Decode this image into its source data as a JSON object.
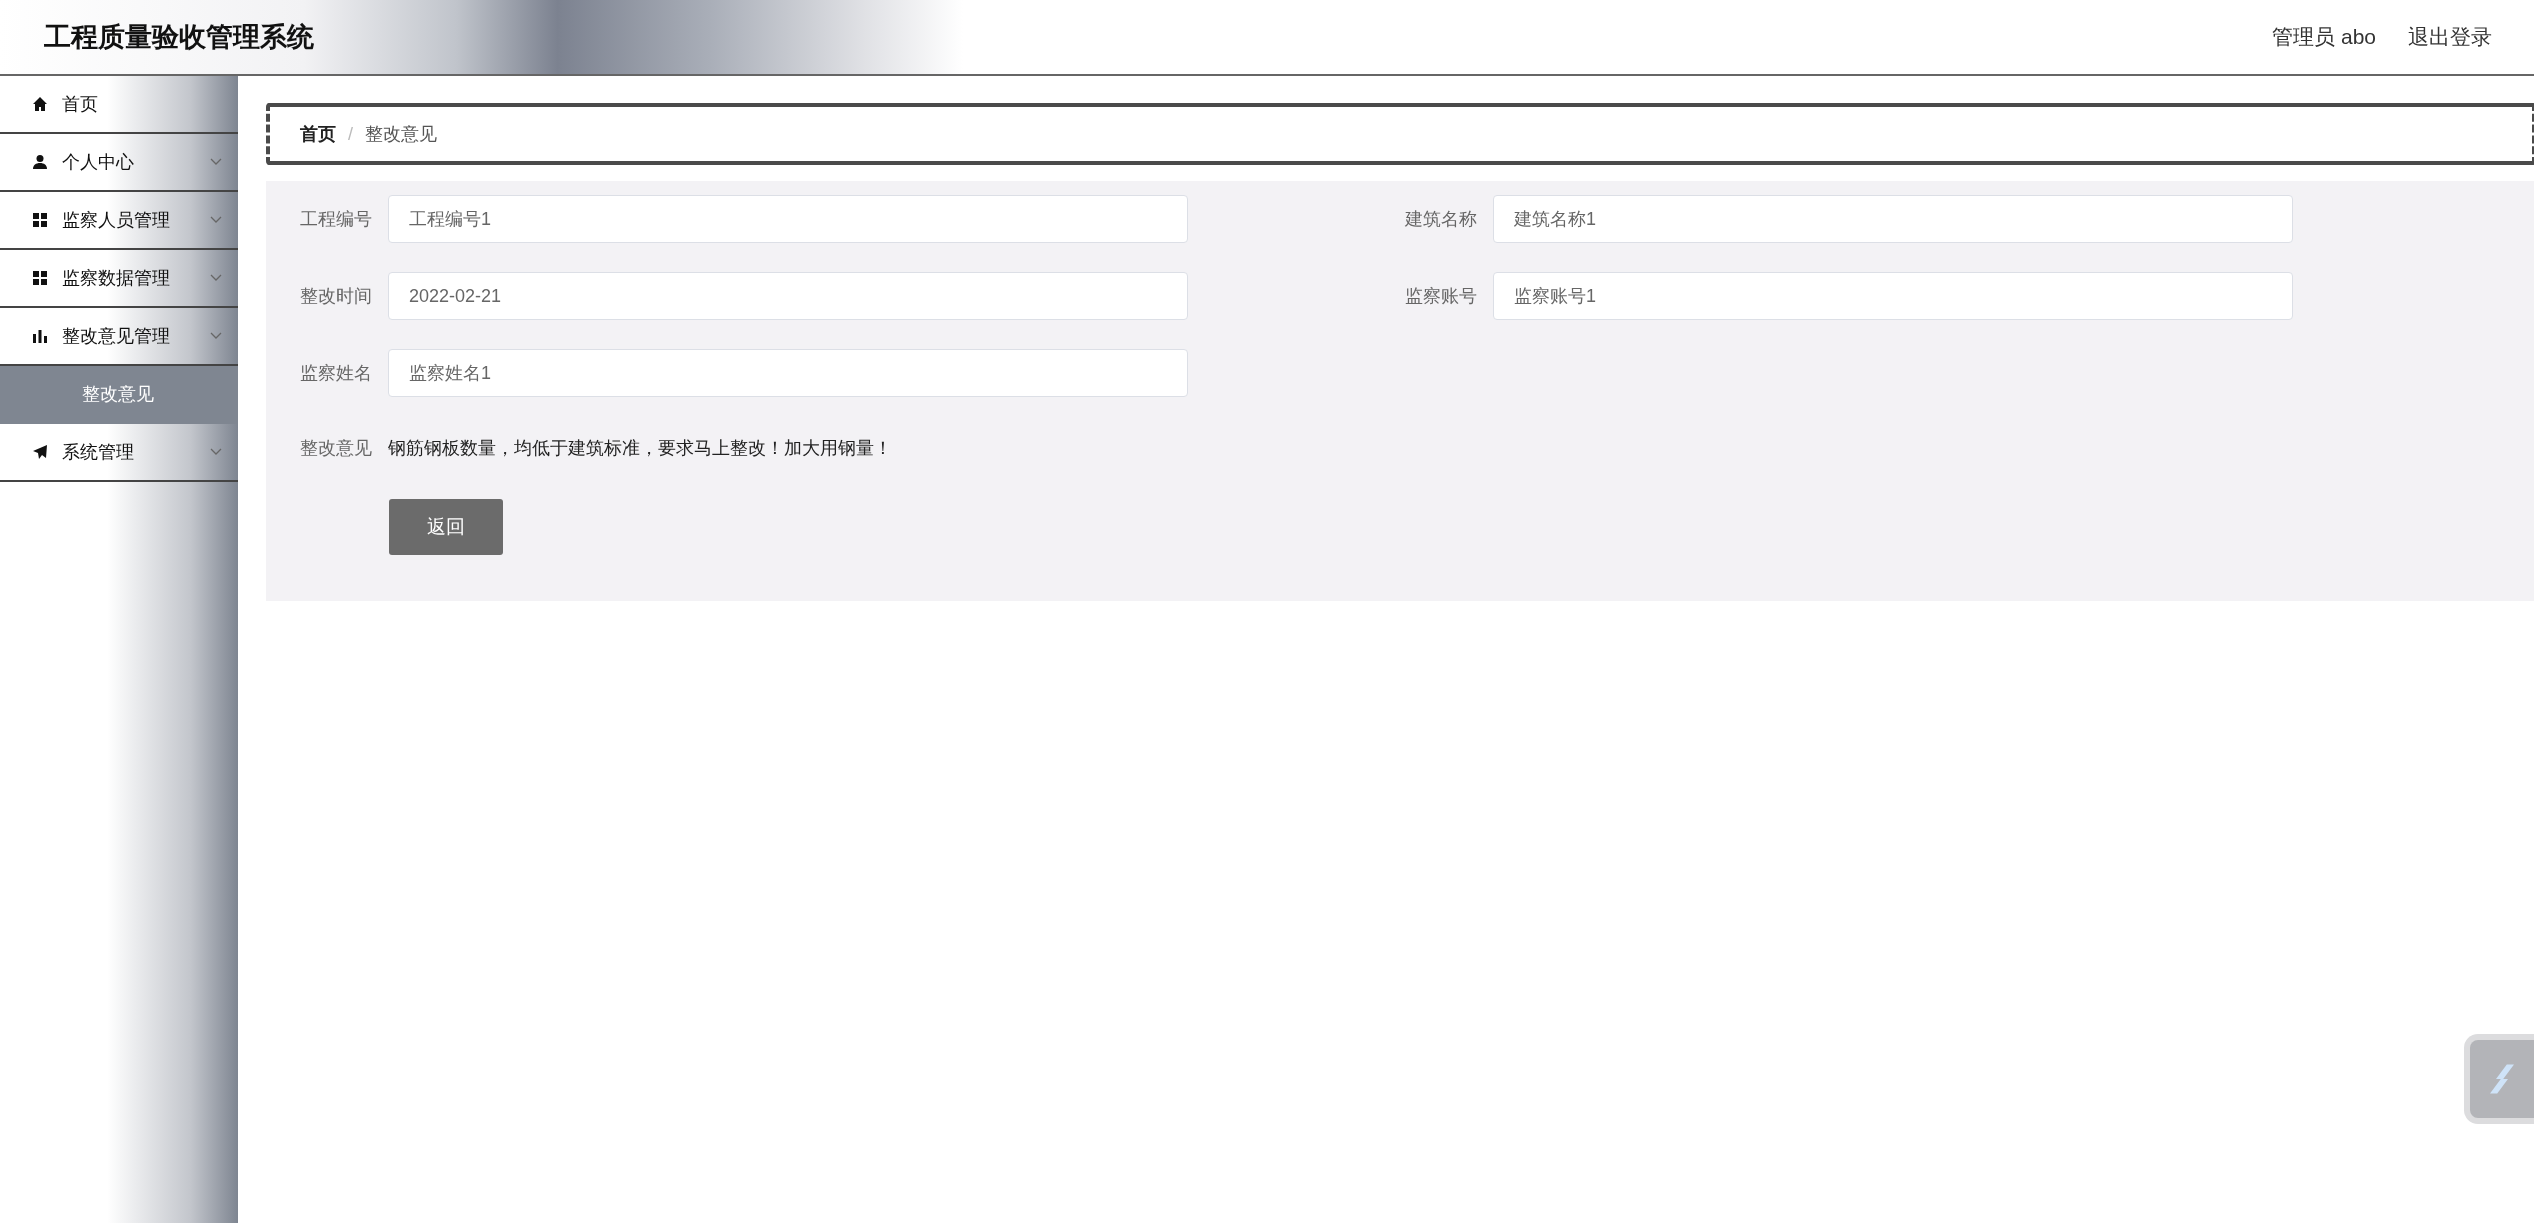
{
  "header": {
    "title": "工程质量验收管理系统",
    "user": "管理员 abo",
    "logout": "退出登录"
  },
  "sidebar": {
    "items": [
      {
        "label": "首页",
        "kind": "item",
        "selected": false
      },
      {
        "label": "个人中心",
        "kind": "group",
        "selected": false
      },
      {
        "label": "监察人员管理",
        "kind": "group",
        "selected": false
      },
      {
        "label": "监察数据管理",
        "kind": "group",
        "selected": false
      },
      {
        "label": "整改意见管理",
        "kind": "group",
        "selected": false,
        "children": [
          {
            "label": "整改意见",
            "selected": true
          }
        ]
      },
      {
        "label": "系统管理",
        "kind": "group",
        "selected": false
      }
    ]
  },
  "breadcrumb": {
    "items": [
      "首页",
      "整改意见"
    ],
    "separator": "/"
  },
  "form": {
    "rows": [
      [
        {
          "label": "工程编号",
          "kind": "input",
          "value": "工程编号1"
        },
        {
          "label": "建筑名称",
          "kind": "input",
          "value": "建筑名称1"
        }
      ],
      [
        {
          "label": "整改时间",
          "kind": "input",
          "value": "2022-02-21"
        },
        {
          "label": "监察账号",
          "kind": "input",
          "value": "监察账号1"
        }
      ],
      [
        {
          "label": "监察姓名",
          "kind": "input",
          "value": "监察姓名1"
        }
      ],
      [
        {
          "label": "整改意见",
          "kind": "text",
          "value": "钢筋钢板数量，均低于建筑标准，要求马上整改！加大用钢量！"
        }
      ]
    ],
    "back_button": "返回"
  }
}
